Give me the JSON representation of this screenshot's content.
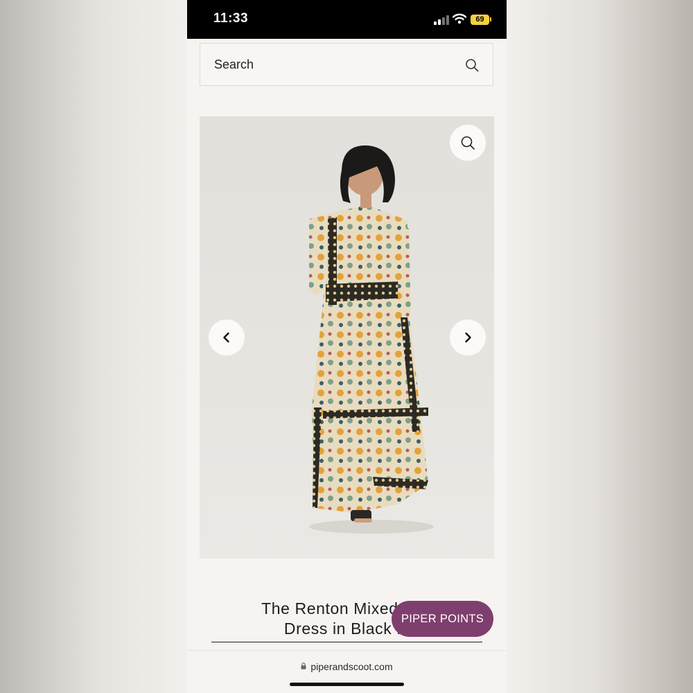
{
  "status_bar": {
    "time": "11:33",
    "battery": "69",
    "icons": [
      "signal-icon",
      "wifi-icon",
      "battery-icon"
    ]
  },
  "search": {
    "placeholder": "Search",
    "icon": "search-icon"
  },
  "gallery": {
    "image_alt": "The Renton Mixed Pattern Dress in Black Multi",
    "buttons": [
      "zoom-icon",
      "chevron-left-icon",
      "chevron-right-icon"
    ]
  },
  "product": {
    "title_line1": "The Renton Mixed Patt",
    "title_line2": "Dress in Black M"
  },
  "piper_points": {
    "label": "PIPER POINTS",
    "color": "#7f3f6e"
  },
  "browser": {
    "url": "piperandscoot.com"
  }
}
